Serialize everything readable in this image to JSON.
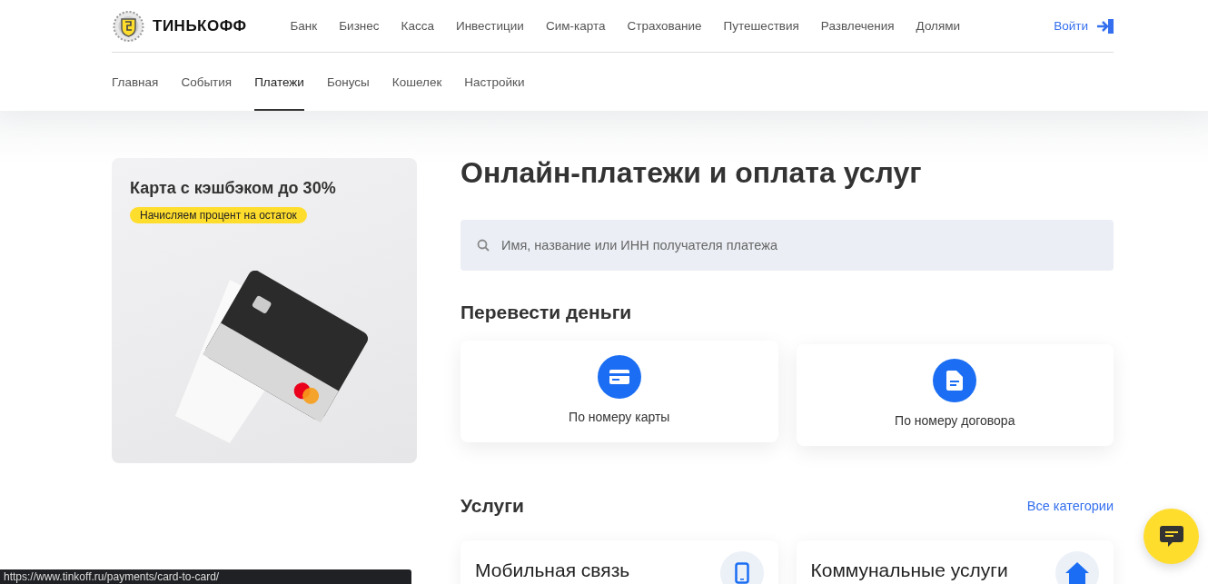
{
  "header": {
    "logo": "ТИНЬКОФФ",
    "nav": [
      "Банк",
      "Бизнес",
      "Касса",
      "Инвестиции",
      "Сим-карта",
      "Страхование",
      "Путешествия",
      "Развлечения",
      "Долями"
    ],
    "login": "Войти"
  },
  "subnav": {
    "tabs": [
      {
        "label": "Главная",
        "selected": false
      },
      {
        "label": "События",
        "selected": false
      },
      {
        "label": "Платежи",
        "selected": true
      },
      {
        "label": "Бонусы",
        "selected": false
      },
      {
        "label": "Кошелек",
        "selected": false
      },
      {
        "label": "Настройки",
        "selected": false
      }
    ]
  },
  "promo": {
    "title": "Карта с кэшбэком до 30%",
    "badge": "Начисляем процент на остаток"
  },
  "main": {
    "title": "Онлайн-платежи и оплата услуг",
    "search": {
      "placeholder": "Имя, название или ИНН получателя платежа"
    },
    "transfer": {
      "title": "Перевести деньги",
      "options": [
        {
          "label": "По номеру карты",
          "kind": "card"
        },
        {
          "label": "По номеру договора",
          "kind": "document"
        }
      ]
    },
    "services": {
      "title": "Услуги",
      "link": "Все категории",
      "items": [
        {
          "label": "Мобильная связь",
          "kind": "phone"
        },
        {
          "label": "Коммунальные услуги",
          "kind": "home"
        }
      ]
    }
  },
  "status_url": "https://www.tinkoff.ru/payments/card-to-card/"
}
